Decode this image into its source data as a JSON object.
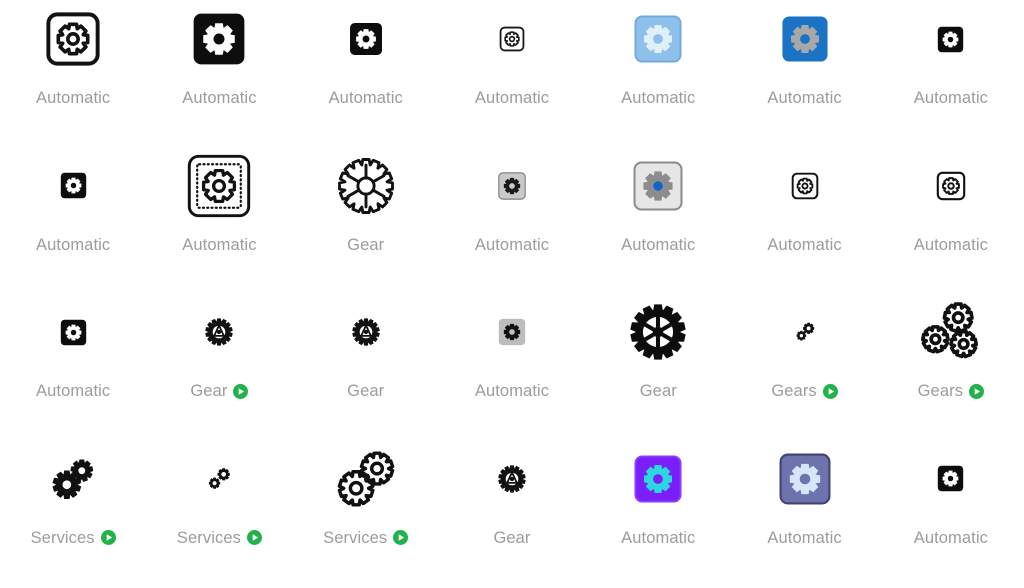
{
  "page": {
    "title": "Gear icon search results",
    "background_color": "#ffffff",
    "label_color": "#9c9c9c",
    "badge_color": "#22b24c",
    "columns": 7,
    "rows": 4
  },
  "badge": {
    "name": "play-badge-icon",
    "meaning": "animated-preview-available",
    "color": "#22b24c",
    "glyph_color": "#ffffff"
  },
  "results": [
    {
      "id": "r1c1",
      "label": "Automatic",
      "badge": false,
      "icon_name": "gear-outline-rounded-square-icon",
      "style": "outline-square",
      "fill": "none",
      "stroke": "#121212",
      "glyph": "#121212",
      "size": 56
    },
    {
      "id": "r1c2",
      "label": "Automatic",
      "badge": false,
      "icon_name": "gear-solid-black-rounded-square-icon",
      "style": "solid-square",
      "fill": "#0d0d0d",
      "stroke": "none",
      "glyph": "#ffffff",
      "size": 54
    },
    {
      "id": "r1c3",
      "label": "Automatic",
      "badge": false,
      "icon_name": "gear-solid-black-small-square-icon",
      "style": "solid-square",
      "fill": "#0d0d0d",
      "stroke": "none",
      "glyph": "#ffffff",
      "size": 34
    },
    {
      "id": "r1c4",
      "label": "Automatic",
      "badge": false,
      "icon_name": "gear-outline-thin-square-icon",
      "style": "outline-square",
      "fill": "none",
      "stroke": "#1a1a1a",
      "glyph": "#1a1a1a",
      "size": 26
    },
    {
      "id": "r1c5",
      "label": "Automatic",
      "badge": false,
      "icon_name": "gear-light-blue-square-icon",
      "style": "solid-square",
      "fill": "#8fc0ec",
      "stroke": "#6fa9de",
      "glyph": "#dff0fb",
      "size": 48
    },
    {
      "id": "r1c6",
      "label": "Automatic",
      "badge": false,
      "icon_name": "gear-blue-square-icon",
      "style": "solid-square",
      "fill": "#1a73c4",
      "stroke": "none",
      "glyph": "#a8a8a8",
      "size": 48
    },
    {
      "id": "r1c7",
      "label": "Automatic",
      "badge": false,
      "icon_name": "gear-solid-black-tiny-square-icon",
      "style": "solid-square",
      "fill": "#0d0d0d",
      "stroke": "none",
      "glyph": "#ffffff",
      "size": 27
    },
    {
      "id": "r2c1",
      "label": "Automatic",
      "badge": false,
      "icon_name": "gear-solid-black-tiny-square-icon",
      "style": "solid-square",
      "fill": "#0d0d0d",
      "stroke": "none",
      "glyph": "#ffffff",
      "size": 27
    },
    {
      "id": "r2c2",
      "label": "Automatic",
      "badge": false,
      "icon_name": "gear-dotted-border-square-icon",
      "style": "dotted-square",
      "fill": "none",
      "stroke": "#121212",
      "glyph": "#121212",
      "size": 66
    },
    {
      "id": "r2c3",
      "label": "Gear",
      "badge": false,
      "icon_name": "cogwheel-spoked-outline-icon",
      "style": "cog-spokes",
      "fill": "none",
      "stroke": "#121212",
      "glyph": "#121212",
      "size": 58
    },
    {
      "id": "r2c4",
      "label": "Automatic",
      "badge": false,
      "icon_name": "gear-gray-square-icon",
      "style": "solid-square",
      "fill": "#c9c9c9",
      "stroke": "#7a7a7a",
      "glyph": "#1a1a1a",
      "size": 28
    },
    {
      "id": "r2c5",
      "label": "Automatic",
      "badge": false,
      "icon_name": "gear-gray-bevel-square-blue-center-icon",
      "style": "solid-square",
      "fill": "#e6e6e6",
      "stroke": "#8a8a8a",
      "glyph": "#8c8c8c",
      "accent": "#1565c0",
      "size": 50
    },
    {
      "id": "r2c6",
      "label": "Automatic",
      "badge": false,
      "icon_name": "gear-outline-square-bold-icon",
      "style": "outline-square",
      "fill": "none",
      "stroke": "#111111",
      "glyph": "#111111",
      "size": 28
    },
    {
      "id": "r2c7",
      "label": "Automatic",
      "badge": false,
      "icon_name": "gear-outline-square-icon",
      "style": "outline-square",
      "fill": "none",
      "stroke": "#111111",
      "glyph": "#111111",
      "size": 30
    },
    {
      "id": "r3c1",
      "label": "Automatic",
      "badge": false,
      "icon_name": "gear-solid-black-tiny-square-icon",
      "style": "solid-square",
      "fill": "#0d0d0d",
      "stroke": "none",
      "glyph": "#ffffff",
      "size": 27
    },
    {
      "id": "r3c2",
      "label": "Gear",
      "badge": true,
      "icon_name": "cogwheel-glyph-small-icon",
      "style": "cog-glyph",
      "fill": "#121212",
      "stroke": "none",
      "glyph": "#121212",
      "size": 30
    },
    {
      "id": "r3c3",
      "label": "Gear",
      "badge": false,
      "icon_name": "cogwheel-glyph-small-icon",
      "style": "cog-glyph",
      "fill": "#121212",
      "stroke": "none",
      "glyph": "#121212",
      "size": 30
    },
    {
      "id": "r3c4",
      "label": "Automatic",
      "badge": false,
      "icon_name": "gear-gray-rounded-square-icon",
      "style": "solid-square",
      "fill": "#bdbdbd",
      "stroke": "none",
      "glyph": "#111111",
      "size": 28
    },
    {
      "id": "r3c5",
      "label": "Gear",
      "badge": false,
      "icon_name": "cogwheel-spoked-solid-icon",
      "style": "cog-solid-spokes",
      "fill": "#0d0d0d",
      "stroke": "none",
      "glyph": "#0d0d0d",
      "size": 58
    },
    {
      "id": "r3c6",
      "label": "Gears",
      "badge": true,
      "icon_name": "two-gears-small-solid-icon",
      "style": "gears-two-small",
      "fill": "#111111",
      "stroke": "none",
      "glyph": "#111111",
      "size": 26
    },
    {
      "id": "r3c7",
      "label": "Gears",
      "badge": true,
      "icon_name": "three-gears-outline-icon",
      "style": "gears-three-outline",
      "fill": "none",
      "stroke": "#111111",
      "glyph": "#111111",
      "size": 60
    },
    {
      "id": "r4c1",
      "label": "Services",
      "badge": true,
      "icon_name": "two-gears-solid-icon",
      "style": "gears-two-solid",
      "fill": "#111111",
      "stroke": "none",
      "glyph": "#111111",
      "size": 44
    },
    {
      "id": "r4c2",
      "label": "Services",
      "badge": true,
      "icon_name": "two-gears-tiny-solid-icon",
      "style": "gears-two-tiny",
      "fill": "#111111",
      "stroke": "none",
      "glyph": "#111111",
      "size": 26
    },
    {
      "id": "r4c3",
      "label": "Services",
      "badge": true,
      "icon_name": "two-gears-outline-icon",
      "style": "gears-two-outline",
      "fill": "none",
      "stroke": "#111111",
      "glyph": "#111111",
      "size": 58
    },
    {
      "id": "r4c4",
      "label": "Gear",
      "badge": false,
      "icon_name": "cogwheel-glyph-small-icon",
      "style": "cog-glyph",
      "fill": "#121212",
      "stroke": "none",
      "glyph": "#121212",
      "size": 30
    },
    {
      "id": "r4c5",
      "label": "Automatic",
      "badge": false,
      "icon_name": "gear-cyan-on-violet-square-icon",
      "style": "solid-square",
      "fill": "#7b1ffa",
      "stroke": "#8b3dfb",
      "glyph": "#2bd8e0",
      "size": 48
    },
    {
      "id": "r4c6",
      "label": "Automatic",
      "badge": false,
      "icon_name": "gear-periwinkle-rounded-square-icon",
      "style": "solid-square",
      "fill": "#6e72ad",
      "stroke": "#3f4470",
      "glyph": "#d6e6f7",
      "size": 52
    },
    {
      "id": "r4c7",
      "label": "Automatic",
      "badge": false,
      "icon_name": "gear-solid-black-tiny-square-icon",
      "style": "solid-square",
      "fill": "#0d0d0d",
      "stroke": "none",
      "glyph": "#ffffff",
      "size": 27
    }
  ]
}
